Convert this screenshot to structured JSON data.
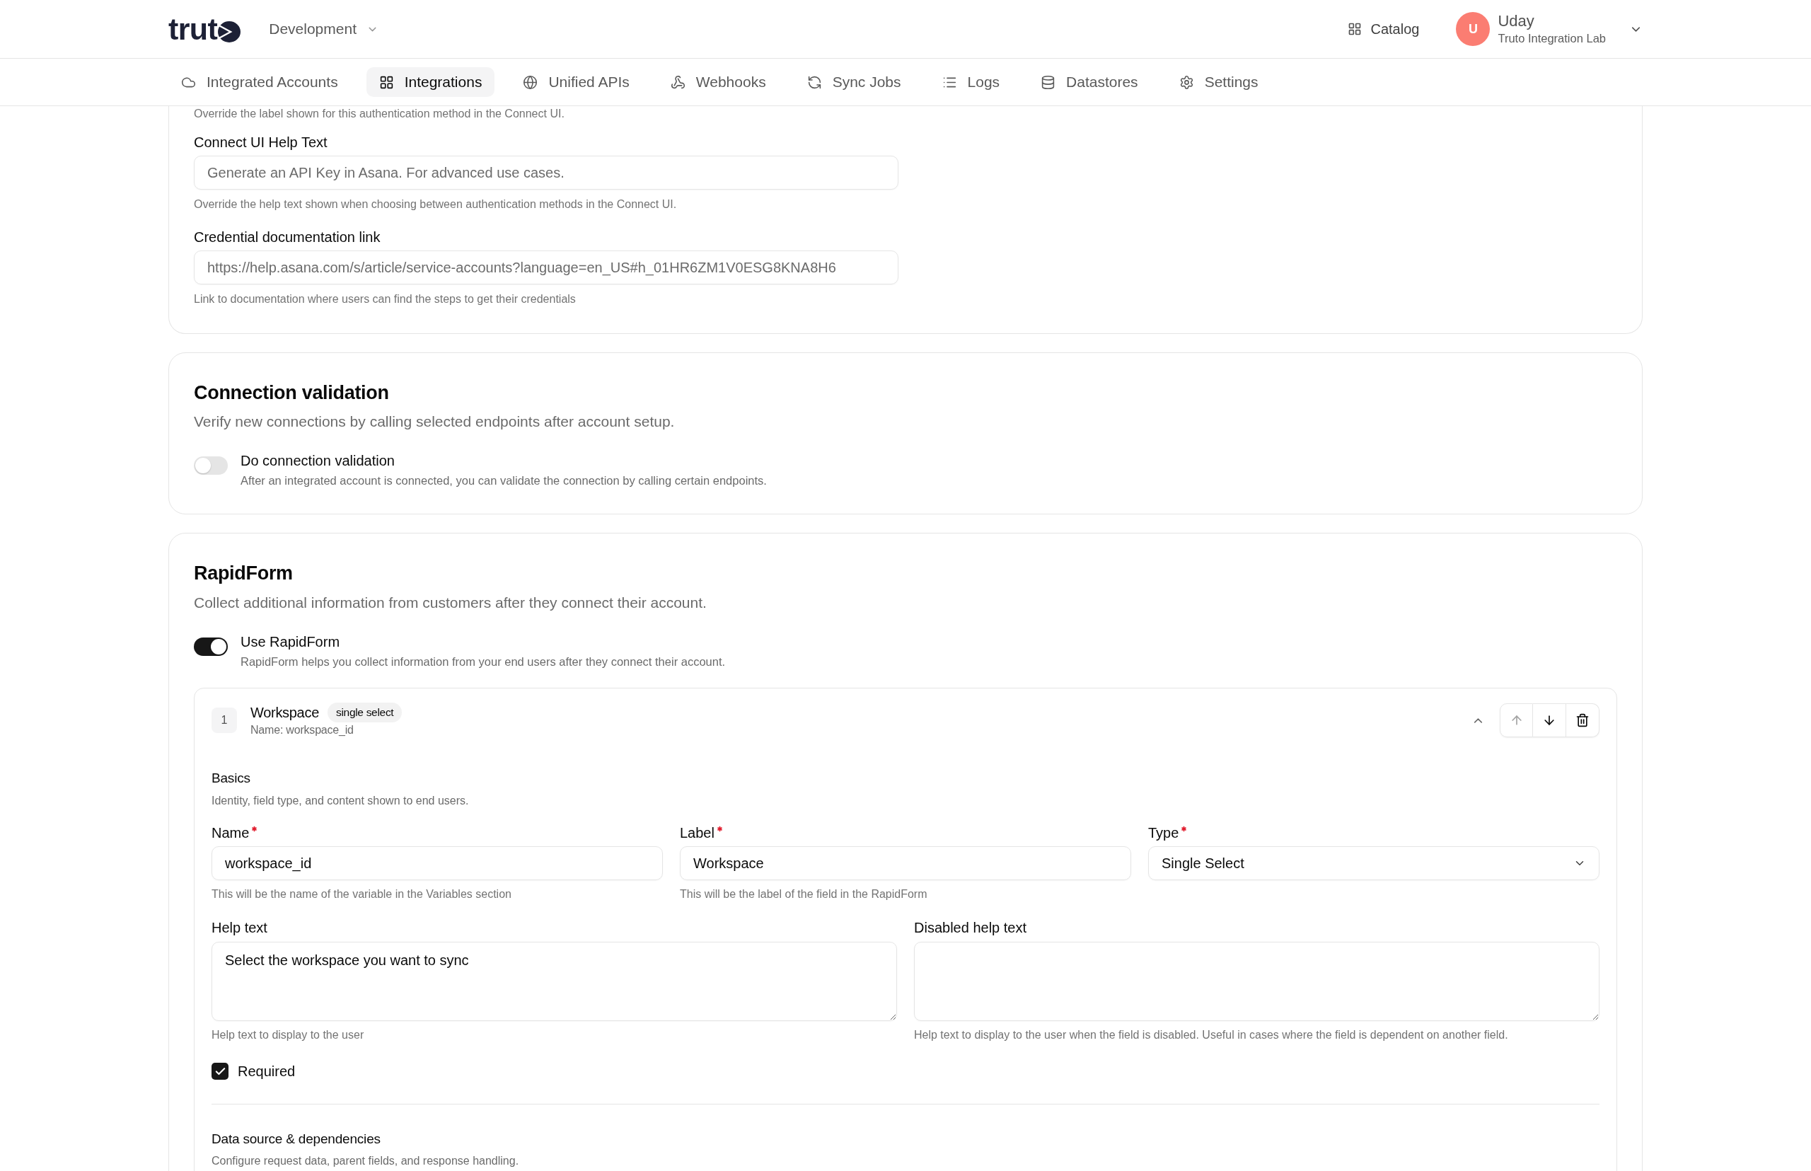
{
  "header": {
    "logo": "trut",
    "environment": "Development",
    "catalog": "Catalog",
    "user": {
      "initial": "U",
      "name": "Uday",
      "organization": "Truto Integration Lab"
    }
  },
  "nav": [
    {
      "label": "Integrated Accounts",
      "selected": false
    },
    {
      "label": "Integrations",
      "selected": true
    },
    {
      "label": "Unified APIs",
      "selected": false
    },
    {
      "label": "Webhooks",
      "selected": false
    },
    {
      "label": "Sync Jobs",
      "selected": false
    },
    {
      "label": "Logs",
      "selected": false
    },
    {
      "label": "Datastores",
      "selected": false
    },
    {
      "label": "Settings",
      "selected": false
    }
  ],
  "auth_section": {
    "note": "Override the label shown for this authentication method in the Connect UI.",
    "fields": [
      {
        "label": "Connect UI Help Text",
        "placeholder": "Generate an API Key in Asana. For advanced use cases.",
        "help": "Override the help text shown when choosing between authentication methods in the Connect UI."
      },
      {
        "label": "Credential documentation link",
        "placeholder": "https://help.asana.com/s/article/service-accounts?language=en_US#h_01HR6ZM1V0ESG8KNA8H6",
        "help": "Link to documentation where users can find the steps to get their credentials"
      }
    ]
  },
  "connection_validation": {
    "title": "Connection validation",
    "description": "Verify new connections by calling selected endpoints after account setup.",
    "toggle": {
      "label": "Do connection validation",
      "description": "After an integrated account is connected, you can validate the connection by calling certain endpoints.",
      "on": false
    }
  },
  "rapidform": {
    "title": "RapidForm",
    "description": "Collect additional information from customers after they connect their account.",
    "toggle": {
      "label": "Use RapidForm",
      "description": "RapidForm helps you collect information from your end users after they connect their account.",
      "on": true
    },
    "fields": [
      {
        "number": "1",
        "title": "Workspace",
        "type_badge": "single select",
        "name_line": "Name: workspace_id",
        "expanded": true,
        "actions": [
          {
            "kind": "move_up",
            "disabled": true
          },
          {
            "kind": "move_down",
            "disabled": false
          },
          {
            "kind": "delete",
            "disabled": false
          }
        ],
        "basics": {
          "title": "Basics",
          "description": "Identity, field type, and content shown to end users.",
          "inputs": [
            {
              "kind": "text",
              "label": "Name",
              "required": true,
              "value": "workspace_id",
              "help": "This will be the name of the variable in the Variables section"
            },
            {
              "kind": "text",
              "label": "Label",
              "required": true,
              "value": "Workspace",
              "help": "This will be the label of the field in the RapidForm"
            },
            {
              "kind": "select",
              "label": "Type",
              "required": true,
              "value": "Single Select"
            }
          ],
          "text_areas": [
            {
              "label": "Help text",
              "value": "Select the workspace you want to sync",
              "help": "Help text to display to the user"
            },
            {
              "label": "Disabled help text",
              "help": "Help text to display to the user when the field is disabled. Useful in cases where the field is dependent on another field."
            }
          ],
          "required_checkbox": {
            "label": "Required",
            "checked": true
          }
        },
        "data_source": {
          "title": "Data source & dependencies",
          "description": "Configure request data, parent fields, and response handling."
        }
      }
    ]
  }
}
